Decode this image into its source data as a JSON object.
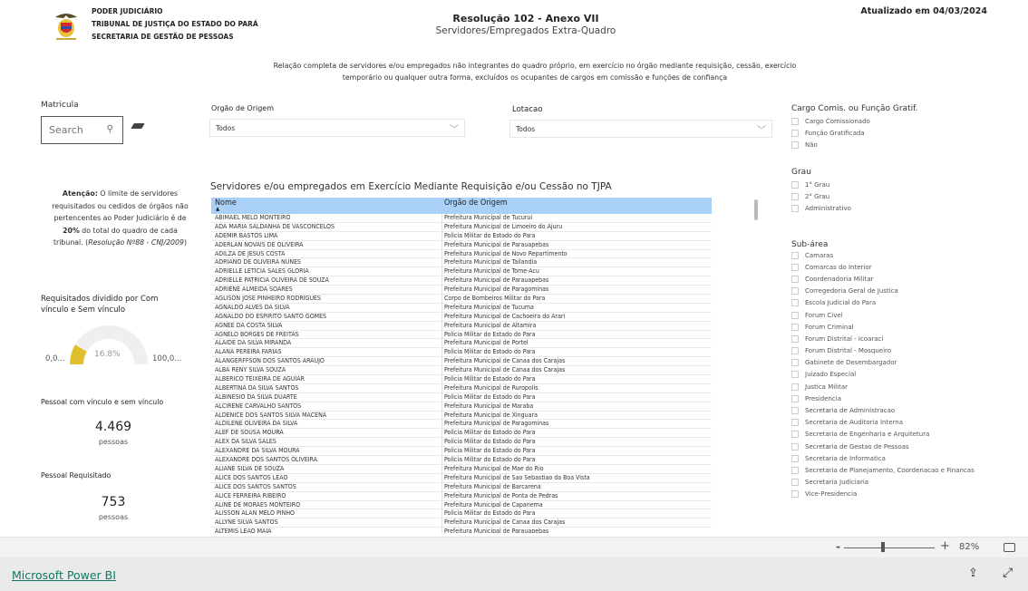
{
  "header": {
    "org_lines": [
      "PODER JUDICIÁRIO",
      "TRIBUNAL DE JUSTIÇA DO ESTADO DO PARÁ",
      "SECRETARIA DE GESTÃO DE PESSOAS"
    ],
    "title": "Resolução 102 - Anexo VII",
    "subtitle": "Servidores/Empregados Extra-Quadro",
    "updated": "Atualizado em 04/03/2024",
    "description": "Relação completa de servidores e/ou empregados não integrantes do quadro próprio, em exercício no órgão mediante requisição, cessão, exercício temporário ou qualquer outra forma, excluídos os ocupantes de cargos em comissão e funções de confiança"
  },
  "left": {
    "matricula_label": "Matricula",
    "search_placeholder": "Search",
    "notice_bold": "Atenção:",
    "notice_text": " O limite de servidores requisitados ou cedidos de órgãos não pertencentes ao Poder Judiciário é de ",
    "notice_pct": "20%",
    "notice_text2": " do total do quadro de cada tribunal. (",
    "notice_ref": "Resolução Nº88 - CNJ/2009",
    "notice_end": ")",
    "gauge_title": "Requisitados dividido por Com vínculo e Sem vínculo",
    "gauge_value": 16.8,
    "gauge_label": "16.8%",
    "gauge_min": "0,0...",
    "gauge_max": "100,0...",
    "gauge_color": "#e0bf2e",
    "card1_title": "Pessoal com vínculo e sem vínculo",
    "card1_value": "4.469",
    "card1_unit": "pessoas",
    "card2_title": "Pessoal Requisitado",
    "card2_value": "753",
    "card2_unit": "pessoas"
  },
  "filters": {
    "orgao_label": "Orgão de Origem",
    "orgao_value": "Todos",
    "lotacao_label": "Lotacao",
    "lotacao_value": "Todos"
  },
  "table": {
    "title": "Servidores e/ou empregados em Exercício Mediante Requisição e/ou Cessão no TJPA",
    "columns": [
      "Nome",
      "Orgão de Origem"
    ],
    "header_color": "#a9d1f7",
    "rows": [
      [
        "ABIMAEL MELO MONTEIRO",
        "Prefeitura Municipal de Tucurui"
      ],
      [
        "ADA MARIA SALDANHA DE VASCONCELOS",
        "Prefeitura Municipal de Limoeiro do Ajuru"
      ],
      [
        "ADEMIR BASTOS LIMA",
        "Policia Militar do Estado do Para"
      ],
      [
        "ADERLAN NOVAIS DE OLIVEIRA",
        "Prefeitura Municipal de Parauapebas"
      ],
      [
        "ADILZA DE JESUS COSTA",
        "Prefeitura Municipal de Novo Repartimento"
      ],
      [
        "ADRIANO DE OLIVEIRA NUNES",
        "Prefeitura Municipal de Tailandia"
      ],
      [
        "ADRIELLE LETICIA SALES GLORIA",
        "Prefeitura Municipal de Tome-Acu"
      ],
      [
        "ADRIELLE PATRICIA OLIVEIRA DE SOUZA",
        "Prefeitura Municipal de Parauapebas"
      ],
      [
        "ADRIENE ALMEIDA SOARES",
        "Prefeitura Municipal de Paragominas"
      ],
      [
        "AGLISON JOSE PINHEIRO RODRIGUES",
        "Corpo de Bombeiros Militar do Para"
      ],
      [
        "AGNALDO ALVES DA SILVA",
        "Prefeitura Municipal de Tucuma"
      ],
      [
        "AGNALDO DO ESPIRITO SANTO GOMES",
        "Prefeitura Municipal de Cachoeira do Arari"
      ],
      [
        "AGNEE DA COSTA SILVA",
        "Prefeitura Municipal de Altamira"
      ],
      [
        "AGNELO BORGES DE FREITAS",
        "Policia Militar do Estado do Para"
      ],
      [
        "ALAIDE DA SILVA MIRANDA",
        "Prefeitura Municipal de Portel"
      ],
      [
        "ALANA PEREIRA FARIAS",
        "Policia Militar do Estado do Para"
      ],
      [
        "ALANGERFFSON DOS SANTOS ARAUJO",
        "Prefeitura Municipal de Canaa dos Carajas"
      ],
      [
        "ALBA RENY SILVA SOUZA",
        "Prefeitura Municipal de Canaa dos Carajas"
      ],
      [
        "ALBERICO TEIXEIRA DE AGUIAR",
        "Policia Militar do Estado do Para"
      ],
      [
        "ALBERTINA DA SILVA SANTOS",
        "Prefeitura Municipal de Ruropolis"
      ],
      [
        "ALBINESIO DA SILVA DUARTE",
        "Policia Militar do Estado do Para"
      ],
      [
        "ALCIRENE CARVALHO SANTOS",
        "Prefeitura Municipal de Maraba"
      ],
      [
        "ALDENICE DOS SANTOS SILVA MACENA",
        "Prefeitura Municipal de Xinguara"
      ],
      [
        "ALDILENE OLIVEIRA DA SILVA",
        "Prefeitura Municipal de Paragominas"
      ],
      [
        "ALEF DE SOUSA MOURA",
        "Policia Militar do Estado do Para"
      ],
      [
        "ALEX DA SILVA SALES",
        "Policia Militar do Estado do Para"
      ],
      [
        "ALEXANDRE DA SILVA MOURA",
        "Policia Militar do Estado do Para"
      ],
      [
        "ALEXANDRE DOS SANTOS OLIVEIRA",
        "Policia Militar do Estado do Para"
      ],
      [
        "ALIANE SILVA DE SOUZA",
        "Prefeitura Municipal de Mae do Rio"
      ],
      [
        "ALICE DOS SANTOS LEAO",
        "Prefeitura Municipal de Sao Sebastiao da Boa Vista"
      ],
      [
        "ALICE DOS SANTOS SANTOS",
        "Prefeitura Municipal de Barcarena"
      ],
      [
        "ALICE FERREIRA RIBEIRO",
        "Prefeitura Municipal de Ponta de Pedras"
      ],
      [
        "ALINE DE MORAES MONTEIRO",
        "Prefeitura Municipal de Capanema"
      ],
      [
        "ALISSON ALAN MELO PINHO",
        "Policia Militar do Estado do Para"
      ],
      [
        "ALLYNE SILVA SANTOS",
        "Prefeitura Municipal de Canaa dos Carajas"
      ],
      [
        "ALTEMIS LEAO MAIA",
        "Prefeitura Municipal de Parauapebas"
      ]
    ]
  },
  "right": {
    "cargo_title": "Cargo Comis. ou Função Gratif.",
    "cargo_items": [
      "Cargo Comissionado",
      "Função Gratificada",
      "Não"
    ],
    "grau_title": "Grau",
    "grau_items": [
      "1° Grau",
      "2° Grau",
      "Administrativo"
    ],
    "sub_title": "Sub-área",
    "sub_items": [
      "Camaras",
      "Comarcas do Interior",
      "Coordenadoria Militar",
      "Corregedoria Geral de Justica",
      "Escola Judicial do Para",
      "Forum Civel",
      "Forum Criminal",
      "Forum Distrital - Icoaraci",
      "Forum Distrital - Mosqueiro",
      "Gabinete de Desembargador",
      "Juizado Especial",
      "Justica Militar",
      "Presidencia",
      "Secretaria de Administracao",
      "Secretaria de Auditoria Interna",
      "Secretaria de Engenharia e Arquitetura",
      "Secretaria de Gestao de Pessoas",
      "Secretaria de Informatica",
      "Secretaria de Planejamento, Coordenacao e Financas",
      "Secretaria Judiciaria",
      "Vice-Presidencia"
    ]
  },
  "footer": {
    "zoom_minus": "-",
    "zoom_plus": "+",
    "zoom_level": "82%",
    "zoom_fraction": 0.41,
    "brand": "Microsoft Power BI"
  }
}
